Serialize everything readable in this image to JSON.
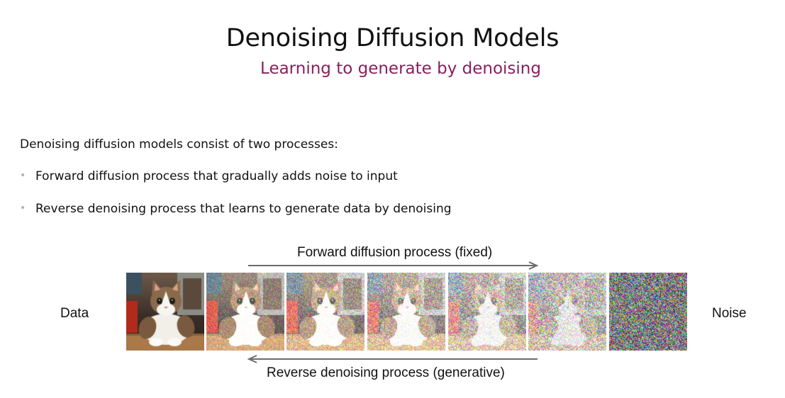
{
  "slide": {
    "title": "Denoising Diffusion Models",
    "subtitle": "Learning to generate by denoising",
    "intro": "Denoising diffusion models consist of two processes:",
    "bullets": [
      "Forward diffusion process that gradually adds noise to input",
      "Reverse denoising process that learns to generate data by denoising"
    ]
  },
  "diagram": {
    "forward_label": "Forward diffusion process (fixed)",
    "reverse_label": "Reverse denoising process (generative)",
    "left_label": "Data",
    "right_label": "Noise",
    "noise_levels": [
      0,
      0.35,
      0.5,
      0.62,
      0.75,
      0.88,
      1.0
    ],
    "colors": {
      "subtitle": "#8a1f5e",
      "arrow": "#6b6b6b",
      "bullet": "#b0b0b0"
    }
  }
}
